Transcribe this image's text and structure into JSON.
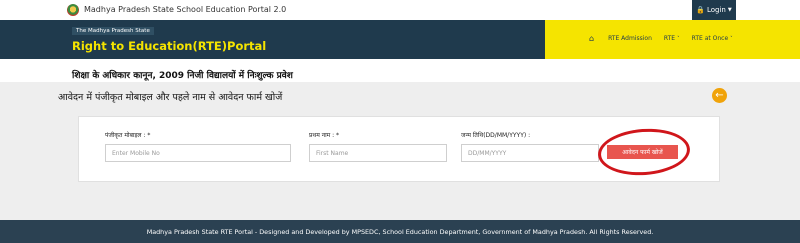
{
  "header": {
    "portal_name": "Madhya Pradesh State School Education Portal 2.0",
    "login_label": "Login",
    "logo_icon": "mp-emblem-icon",
    "login_icon": "lock-icon"
  },
  "banner": {
    "state_tag": "The Madhya Pradesh State",
    "title": "Right to Education(RTE)Portal",
    "colors": {
      "left": "#1f3a4d",
      "right": "#f5e400",
      "title": "#f5e400"
    }
  },
  "nav": {
    "home_icon": "home-icon",
    "items": [
      {
        "label": "RTE Admission",
        "has_dropdown": false
      },
      {
        "label": "RTE",
        "has_dropdown": true
      },
      {
        "label": "RTE at Once",
        "has_dropdown": true
      }
    ]
  },
  "main": {
    "hindi_heading": "शिक्षा के अधिकार कानून, 2009 निजी विद्यालयों में निःशुल्क प्रवेश",
    "search_heading": "आवेदन में पंजीकृत मोबाइल और पहले नाम से आवेदन फार्म खोजें",
    "back_icon": "arrow-left-icon"
  },
  "form": {
    "mobile": {
      "label": "पंजीकृत मोबाइल : *",
      "placeholder": "Enter Mobile No",
      "value": ""
    },
    "first_name": {
      "label": "प्रथम नाम : *",
      "placeholder": "First Name",
      "value": ""
    },
    "dob": {
      "label": "जन्म तिथि(DD/MM/YYYY) :",
      "placeholder": "DD/MM/YYYY",
      "value": ""
    },
    "search_button": "आवेदन फार्म खोजें",
    "accent": "#e8554e"
  },
  "footer": {
    "text": "Madhya Pradesh State RTE Portal - Designed and Developed by MPSEDC, School Education Department, Government of Madhya Pradesh. All Rights Reserved."
  }
}
